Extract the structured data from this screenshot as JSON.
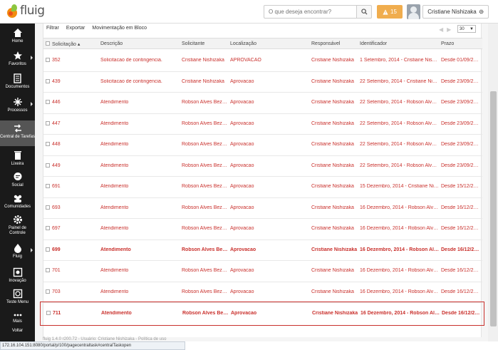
{
  "brand": {
    "logo_text": "fluig"
  },
  "header": {
    "search_placeholder": "O que deseja encontrar?",
    "alerts_count": "15",
    "user_name": "Cristiane Nishizaka"
  },
  "sidebar": {
    "items": [
      {
        "label": "Home"
      },
      {
        "label": "Favoritos"
      },
      {
        "label": "Documentos"
      },
      {
        "label": "Processos"
      },
      {
        "label": "Central de Tarefas"
      },
      {
        "label": "Lixeira"
      },
      {
        "label": "Social"
      },
      {
        "label": "Comunidades"
      },
      {
        "label": "Painel de Controle"
      },
      {
        "label": "Fluig"
      },
      {
        "label": "Inovação"
      },
      {
        "label": "Teste Menu"
      },
      {
        "label": "Mais"
      },
      {
        "label": "Voltar"
      }
    ]
  },
  "toolbar": {
    "filter": "Filtrar",
    "export": "Exportar",
    "bulk": "Movimentação em Bloco",
    "page_size": "30"
  },
  "table": {
    "columns": [
      "Solicitação",
      "Descrição",
      "Solicitante",
      "Localização",
      "Responsável",
      "Identificador",
      "Prazo"
    ],
    "rows": [
      {
        "id": "352",
        "desc": "Solicitacao de contingencia.",
        "requester": "Cristiane Nishizaka",
        "location": "APROVACAO",
        "responsible": "Cristiane Nishizaka",
        "identifier": "1 Setembro, 2014 - Cristiane Nishizaka",
        "deadline": "Desde 01/09/2014"
      },
      {
        "id": "439",
        "desc": "Solicitacao de contingencia.",
        "requester": "Cristiane Nishizaka",
        "location": "Aprovacao",
        "responsible": "Cristiane Nishizaka",
        "identifier": "22 Setembro, 2014 - Cristiane Nishizaka",
        "deadline": "Desde 23/09/2014"
      },
      {
        "id": "446",
        "desc": "Atendimento",
        "requester": "Robson Alves Bezerra",
        "location": "Aprovacao",
        "responsible": "Cristiane Nishizaka",
        "identifier": "22 Setembro, 2014 - Robson Alves Bezerra",
        "deadline": "Desde 23/09/2014"
      },
      {
        "id": "447",
        "desc": "Atendimento",
        "requester": "Robson Alves Bezerra",
        "location": "Aprovacao",
        "responsible": "Cristiane Nishizaka",
        "identifier": "22 Setembro, 2014 - Robson Alves Bezerra",
        "deadline": "Desde 23/09/2014"
      },
      {
        "id": "448",
        "desc": "Atendimento",
        "requester": "Robson Alves Bezerra",
        "location": "Aprovacao",
        "responsible": "Cristiane Nishizaka",
        "identifier": "22 Setembro, 2014 - Robson Alves Bezerra",
        "deadline": "Desde 23/09/2014"
      },
      {
        "id": "449",
        "desc": "Atendimento",
        "requester": "Robson Alves Bezerra",
        "location": "Aprovacao",
        "responsible": "Cristiane Nishizaka",
        "identifier": "22 Setembro, 2014 - Robson Alves Bezerra",
        "deadline": "Desde 23/09/2014"
      },
      {
        "id": "691",
        "desc": "Atendimento",
        "requester": "Robson Alves Bezerra",
        "location": "Aprovacao",
        "responsible": "Cristiane Nishizaka",
        "identifier": "15 Dezembro, 2014 - Cristiane Nishizaka",
        "deadline": "Desde 15/12/2014"
      },
      {
        "id": "693",
        "desc": "Atendimento",
        "requester": "Robson Alves Bezerra",
        "location": "Aprovacao",
        "responsible": "Cristiane Nishizaka",
        "identifier": "16 Dezembro, 2014 - Robson Alves Bezerra",
        "deadline": "Desde 16/12/2014"
      },
      {
        "id": "697",
        "desc": "Atendimento",
        "requester": "Robson Alves Bezerra",
        "location": "Aprovacao",
        "responsible": "Cristiane Nishizaka",
        "identifier": "16 Dezembro, 2014 - Robson Alves Bezerra",
        "deadline": "Desde 16/12/2014"
      },
      {
        "id": "699",
        "desc": "Atendimento",
        "requester": "Robson Alves Bezerra",
        "location": "Aprovacao",
        "responsible": "Cristiane Nishizaka",
        "identifier": "16 Dezembro, 2014 - Robson Alves Bezerra",
        "deadline": "Desde 16/12/2014",
        "bold": true
      },
      {
        "id": "701",
        "desc": "Atendimento",
        "requester": "Robson Alves Bezerra",
        "location": "Aprovacao",
        "responsible": "Cristiane Nishizaka",
        "identifier": "16 Dezembro, 2014 - Robson Alves Bezerra",
        "deadline": "Desde 16/12/2014"
      },
      {
        "id": "703",
        "desc": "Atendimento",
        "requester": "Robson Alves Bezerra",
        "location": "Aprovacao",
        "responsible": "Cristiane Nishizaka",
        "identifier": "16 Dezembro, 2014 - Robson Alves Bezerra",
        "deadline": "Desde 16/12/2014"
      },
      {
        "id": "711",
        "desc": "Atendimento",
        "requester": "Robson Alves Bezerra",
        "location": "Aprovacao",
        "responsible": "Cristiane Nishizaka",
        "identifier": "16 Dezembro, 2014 - Robson Alves Bezerra",
        "deadline": "Desde 16/12/2014",
        "bold": true
      }
    ]
  },
  "footer": {
    "text": "fluig 1.4.0 r200.72 - Usuário: Cristiane Nishizaka - Política de uso"
  },
  "status_url": "172.16.104.151:8080/portal/p/100/pagecentraltask#centralTaskopen",
  "colors": {
    "link_red": "#c9302c",
    "sidebar_bg": "#1a1a1a",
    "alert_orange": "#f0ad4e"
  }
}
